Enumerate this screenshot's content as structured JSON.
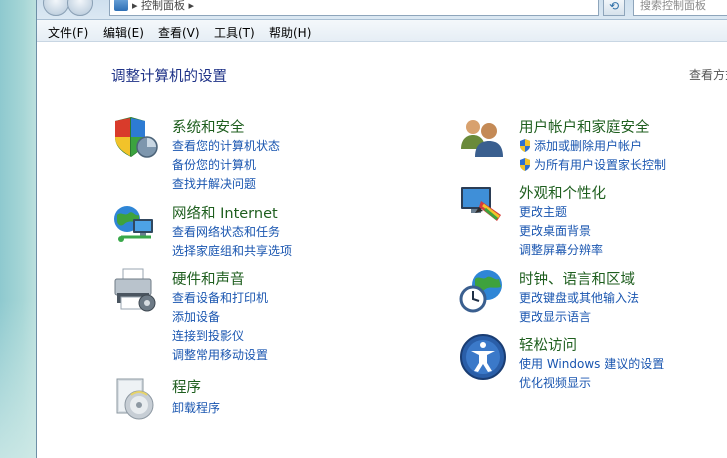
{
  "addressbar": {
    "path": "控制面板",
    "search_placeholder": "搜索控制面板"
  },
  "menu": {
    "file": "文件(F)",
    "edit": "编辑(E)",
    "view": "查看(V)",
    "tools": "工具(T)",
    "help": "帮助(H)"
  },
  "page": {
    "title": "调整计算机的设置",
    "view_by": "查看方式"
  },
  "categories": {
    "system": {
      "title": "系统和安全",
      "links": [
        "查看您的计算机状态",
        "备份您的计算机",
        "查找并解决问题"
      ]
    },
    "network": {
      "title": "网络和 Internet",
      "links": [
        "查看网络状态和任务",
        "选择家庭组和共享选项"
      ]
    },
    "hardware": {
      "title": "硬件和声音",
      "links": [
        "查看设备和打印机",
        "添加设备",
        "连接到投影仪",
        "调整常用移动设置"
      ]
    },
    "programs": {
      "title": "程序",
      "links": [
        "卸载程序"
      ]
    },
    "users": {
      "title": "用户帐户和家庭安全",
      "links": [
        "添加或删除用户帐户",
        "为所有用户设置家长控制"
      ]
    },
    "appearance": {
      "title": "外观和个性化",
      "links": [
        "更改主题",
        "更改桌面背景",
        "调整屏幕分辨率"
      ]
    },
    "clock": {
      "title": "时钟、语言和区域",
      "links": [
        "更改键盘或其他输入法",
        "更改显示语言"
      ]
    },
    "ease": {
      "title": "轻松访问",
      "links": [
        "使用 Windows 建议的设置",
        "优化视频显示"
      ]
    }
  },
  "colors": {
    "category_title": "#1e5e1e",
    "link": "#1a56b0",
    "page_title": "#1e3287"
  }
}
